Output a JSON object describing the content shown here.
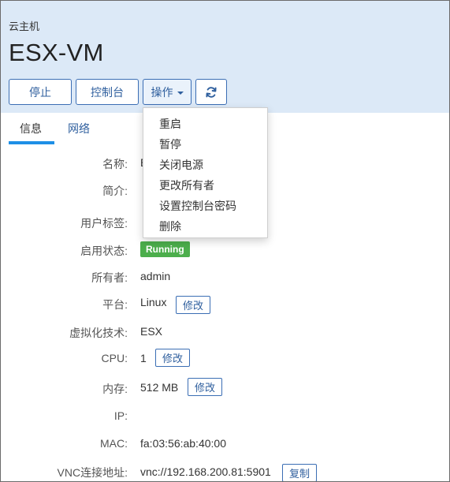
{
  "breadcrumb": "云主机",
  "title": "ESX-VM",
  "toolbar": {
    "stop_label": "停止",
    "console_label": "控制台",
    "actions_label": "操作",
    "refresh_icon": "refresh-icon"
  },
  "tabs": [
    {
      "label": "信息",
      "active": true
    },
    {
      "label": "网络",
      "active": false
    }
  ],
  "actions_menu": [
    "重启",
    "暂停",
    "关闭电源",
    "更改所有者",
    "设置控制台密码",
    "删除"
  ],
  "details": {
    "name": {
      "label": "名称:",
      "value": "E"
    },
    "description": {
      "label": "简介:"
    },
    "user_tags": {
      "label": "用户标签:"
    },
    "status": {
      "label": "启用状态:",
      "value": "Running",
      "color": "#4cae4c"
    },
    "owner": {
      "label": "所有者:",
      "value": "admin"
    },
    "platform": {
      "label": "平台:",
      "value": "Linux",
      "edit_label": "修改"
    },
    "virtualization": {
      "label": "虚拟化技术:",
      "value": "ESX"
    },
    "cpu": {
      "label": "CPU:",
      "value": "1",
      "edit_label": "修改"
    },
    "memory": {
      "label": "内存:",
      "value": "512 MB",
      "edit_label": "修改"
    },
    "ip": {
      "label": "IP:"
    },
    "mac": {
      "label": "MAC:",
      "value": "fa:03:56:ab:40:00"
    },
    "vnc": {
      "label": "VNC连接地址:",
      "value": "vnc://192.168.200.81:5901",
      "copy_label": "复制"
    }
  },
  "colors": {
    "header_bg": "#dce9f7",
    "accent": "#2f5f9e",
    "tab_underline": "#1e8fe6",
    "running": "#4cae4c"
  }
}
